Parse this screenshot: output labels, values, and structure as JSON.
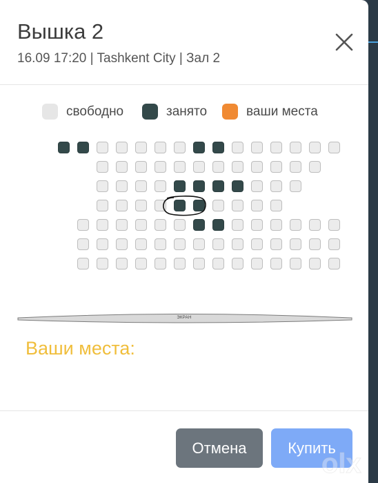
{
  "modal": {
    "title": "Вышка 2",
    "subtitle": "16.09 17:20 | Tashkent City | Зал 2",
    "colors": {
      "free": "#ececec",
      "taken": "#33494a",
      "mine": "#f08a33",
      "cancel": "#6c757d",
      "buy": "#7eaaf7",
      "accent_text": "#f0be3c"
    }
  },
  "legend": {
    "free": "свободно",
    "taken": "занято",
    "mine": "ваши места"
  },
  "seat_rows": [
    [
      0,
      1,
      1,
      0,
      0,
      0,
      0,
      0,
      1,
      1,
      0,
      0,
      0,
      0,
      0,
      0
    ],
    [
      2,
      0,
      0,
      0,
      0,
      0,
      0,
      0,
      0,
      0,
      0,
      0,
      0
    ],
    [
      2,
      0,
      0,
      0,
      0,
      1,
      1,
      1,
      1,
      0,
      0,
      0
    ],
    [
      2,
      0,
      0,
      0,
      0,
      1,
      1,
      0,
      0,
      0,
      0
    ],
    [
      1,
      0,
      0,
      0,
      0,
      0,
      0,
      1,
      1,
      0,
      0,
      0,
      0,
      0,
      0
    ],
    [
      1,
      0,
      0,
      0,
      0,
      0,
      0,
      0,
      0,
      0,
      0,
      0,
      0,
      0,
      0
    ],
    [
      1,
      0,
      0,
      0,
      0,
      0,
      0,
      0,
      0,
      0,
      0,
      0,
      0,
      0,
      0
    ]
  ],
  "screen_label": "ЭКРАН",
  "selected": {
    "label": "Ваши места:"
  },
  "buttons": {
    "cancel": "Отмена",
    "buy": "Купить"
  },
  "icons": {
    "close": "close-icon",
    "watermark": "olx-watermark-logo"
  },
  "watermark_text": "olx.uz"
}
